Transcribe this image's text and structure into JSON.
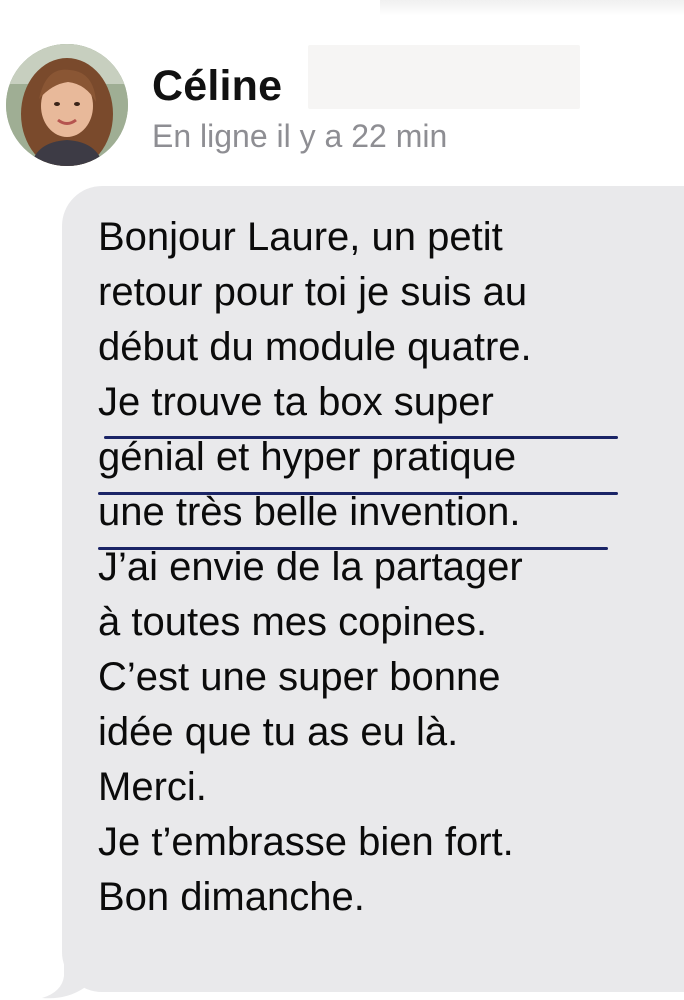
{
  "contact": {
    "name": "Céline",
    "status": "En ligne il y a 22 min",
    "avatar_icon": "profile-photo"
  },
  "message": {
    "lines": [
      "Bonjour Laure, un petit",
      "retour pour toi je suis au",
      "début du module quatre.",
      "Je trouve ta box super",
      "génial et hyper pratique",
      "une très belle invention.",
      "J’ai envie de la partager",
      "à toutes mes copines.",
      "C’est une super bonne",
      "idée que tu as eu là.",
      "Merci.",
      "Je t’embrasse bien fort.",
      "Bon dimanche."
    ]
  },
  "colors": {
    "bubble": "#e9e9eb",
    "underline": "#1a2466",
    "status_text": "#8e8e93"
  }
}
